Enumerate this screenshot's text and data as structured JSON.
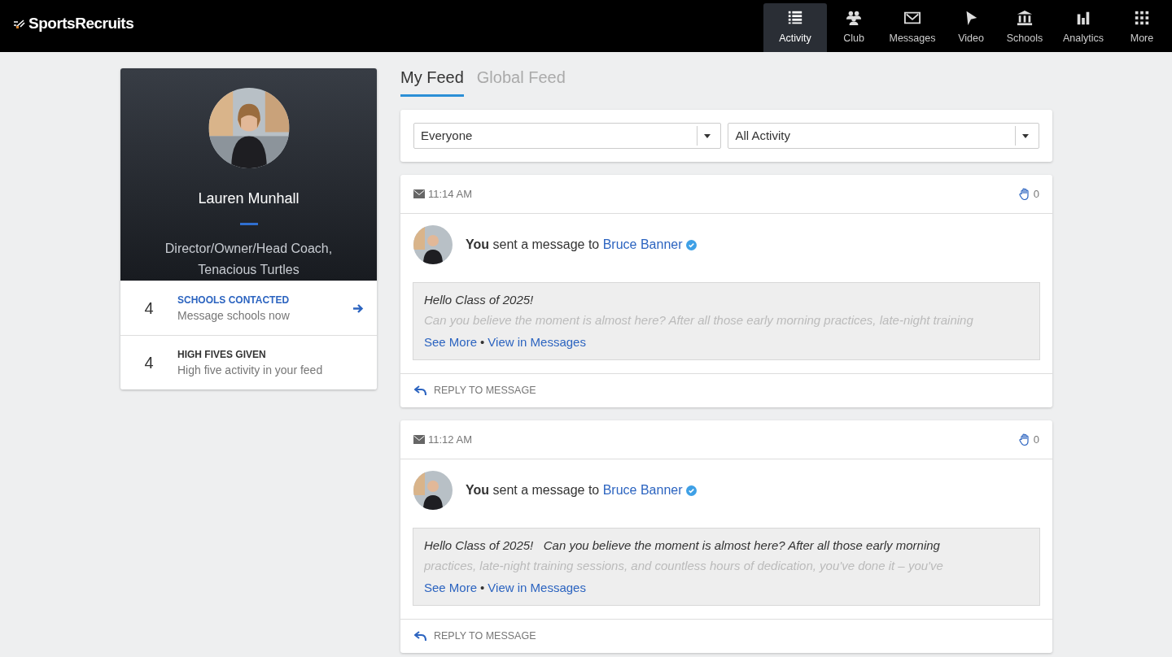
{
  "brand": "SportsRecruits",
  "nav": [
    {
      "label": "Activity",
      "selected": true
    },
    {
      "label": "Club",
      "selected": false
    },
    {
      "label": "Messages",
      "selected": false
    },
    {
      "label": "Video",
      "selected": false
    },
    {
      "label": "Schools",
      "selected": false
    },
    {
      "label": "Analytics",
      "selected": false
    },
    {
      "label": "More",
      "selected": false
    }
  ],
  "profile": {
    "name": "Lauren Munhall",
    "role": "Director/Owner/Head Coach, Tenacious Turtles",
    "stats": [
      {
        "count": "4",
        "title": "SCHOOLS CONTACTED",
        "subtitle": "Message schools now",
        "link": true
      },
      {
        "count": "4",
        "title": "HIGH FIVES GIVEN",
        "subtitle": "High five activity in your feed",
        "link": false
      }
    ]
  },
  "feed_tabs": [
    {
      "label": "My Feed",
      "selected": true
    },
    {
      "label": "Global Feed",
      "selected": false
    }
  ],
  "filters": [
    {
      "value": "Everyone"
    },
    {
      "value": "All Activity"
    }
  ],
  "posts": [
    {
      "time": "11:14 AM",
      "high_fives": "0",
      "actor": "You",
      "action": "sent a message to",
      "recipient": "Bruce Banner",
      "verified": true,
      "lines": [
        "Hello Class of 2025!",
        "Can you believe the moment is almost here? After all those early morning practices, late-night training"
      ],
      "see_more": "See More",
      "bullet": "•",
      "view": "View in Messages",
      "reply": "REPLY TO MESSAGE"
    },
    {
      "time": "11:12 AM",
      "high_fives": "0",
      "actor": "You",
      "action": "sent a message to",
      "recipient": "Bruce Banner",
      "verified": true,
      "lines": [
        "Hello Class of 2025!   Can you believe the moment is almost here? After all those early morning",
        "practices, late-night training sessions, and countless hours of dedication, you've done it – you've"
      ],
      "see_more": "See More",
      "bullet": "•",
      "view": "View in Messages",
      "reply": "REPLY TO MESSAGE"
    }
  ]
}
